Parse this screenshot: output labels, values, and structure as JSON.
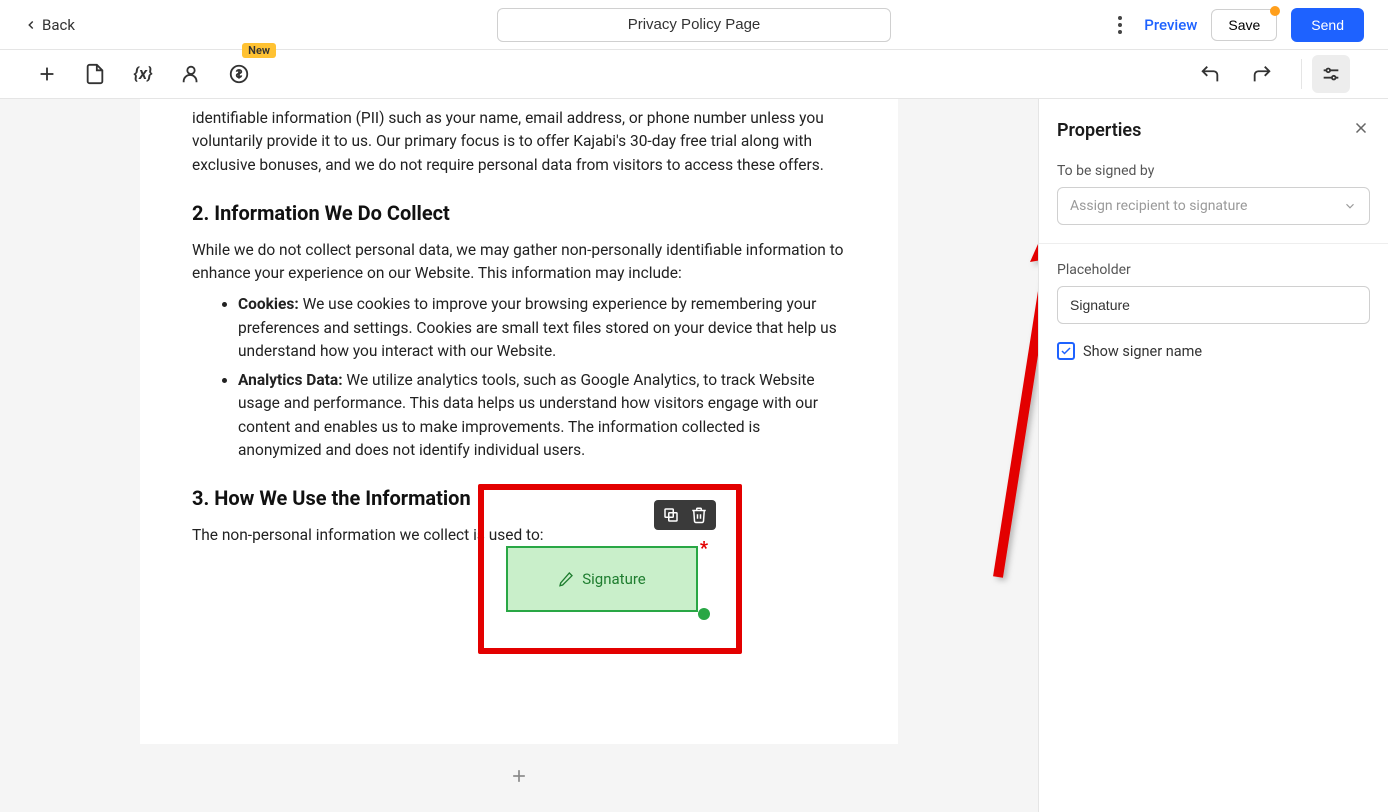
{
  "topbar": {
    "back_label": "Back",
    "title_value": "Privacy Policy Page",
    "preview_label": "Preview",
    "save_label": "Save",
    "send_label": "Send"
  },
  "toolbar2": {
    "new_badge": "New"
  },
  "document": {
    "para_top": "identifiable information (PII) such as your name, email address, or phone number unless you voluntarily provide it to us. Our primary focus is to offer Kajabi's 30-day free trial along with exclusive bonuses, and we do not require personal data from visitors to access these offers.",
    "h2": "2. Information We Do Collect",
    "para2": "While we do not collect personal data, we may gather non-personally identifiable information to enhance your experience on our Website. This information may include:",
    "li_cookies_label": "Cookies:",
    "li_cookies_body": " We use cookies to improve your browsing experience by remembering your preferences and settings. Cookies are small text files stored on your device that help us understand how you interact with our Website.",
    "li_analytics_label": "Analytics Data:",
    "li_analytics_body": " We utilize analytics tools, such as Google Analytics, to track Website usage and performance. This data helps us understand how visitors engage with our content and enables us to make improvements. The information collected is anonymized and does not identify individual users.",
    "h3": "3. How We Use the Information",
    "para3": "The non-personal information we collect is used to:",
    "signature_label": "Signature"
  },
  "properties": {
    "title": "Properties",
    "to_be_signed_by_label": "To be signed by",
    "assign_placeholder": "Assign recipient to signature",
    "placeholder_label": "Placeholder",
    "placeholder_value": "Signature",
    "show_signer_label": "Show signer name"
  }
}
